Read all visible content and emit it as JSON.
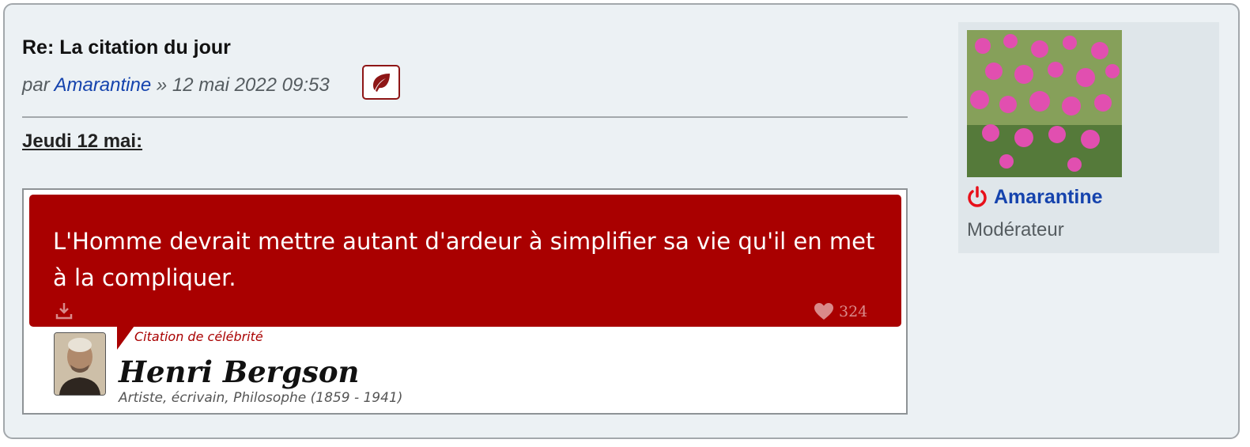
{
  "post": {
    "title": "Re: La citation du jour",
    "meta_prefix": "par ",
    "author": "Amarantine",
    "meta_separator": " » ",
    "date": "12 mai 2022 09:53",
    "report_icon": "leaf-icon",
    "date_heading": "Jeudi 12 mai:"
  },
  "quote": {
    "text": "L'Homme devrait mettre autant d'ardeur à simplifier sa vie qu'il en met à la compliquer.",
    "likes": "324",
    "category": "Citation de célébrité",
    "author_name": "Henri Bergson",
    "author_desc": "Artiste, écrivain, Philosophe (1859 - 1941)",
    "accent_color": "#a90000"
  },
  "profile": {
    "name": "Amarantine",
    "rank": "Modérateur",
    "status_icon": "power-icon",
    "status_color": "#e8101a"
  }
}
